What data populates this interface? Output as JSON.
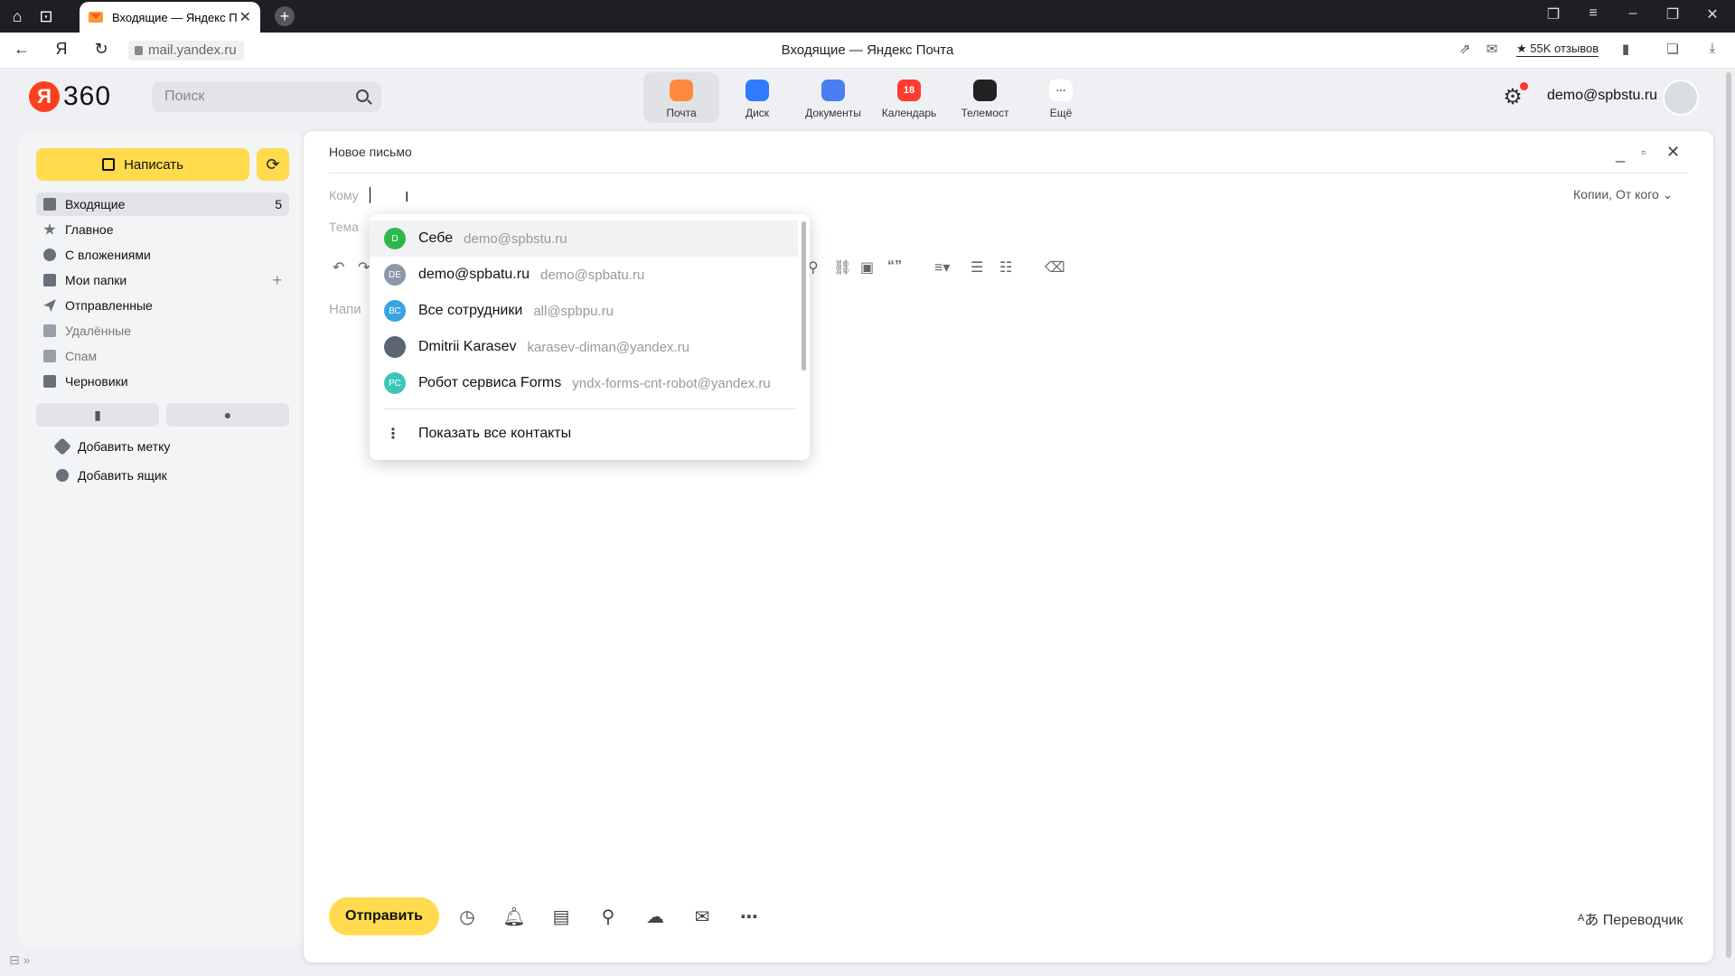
{
  "browser": {
    "tab_title": "Входящие — Яндекс П",
    "tab_close": "✕",
    "page_title": "Входящие — Яндекс Почта",
    "url": "mail.yandex.ru",
    "reviews": "★ 55K отзывов"
  },
  "header": {
    "logo_ya": "Я",
    "logo_360": "360",
    "search_placeholder": "Поиск",
    "services": [
      {
        "label": "Почта",
        "icon": "mail-icon",
        "color": "#ff8a3d"
      },
      {
        "label": "Диск",
        "icon": "disk-icon",
        "color": "#2f7bff"
      },
      {
        "label": "Документы",
        "icon": "documents-icon",
        "color": "#4a7ff0"
      },
      {
        "label": "Календарь",
        "icon": "calendar-icon",
        "color": "#ff3b30",
        "badge": "18"
      },
      {
        "label": "Телемост",
        "icon": "telemost-icon",
        "color": "#222222"
      },
      {
        "label": "Ещё",
        "icon": "more-icon",
        "color": "#ffffff",
        "glyph": "⋯"
      }
    ],
    "user_email": "demo@spbstu.ru"
  },
  "sidebar": {
    "compose_label": "Написать",
    "folders": [
      {
        "label": "Входящие",
        "count": "5"
      },
      {
        "label": "Главное"
      },
      {
        "label": "С вложениями"
      },
      {
        "label": "Мои папки",
        "add": "+"
      },
      {
        "label": "Отправленные"
      },
      {
        "label": "Удалённые"
      },
      {
        "label": "Спам"
      },
      {
        "label": "Черновики"
      }
    ],
    "add_label": "Добавить метку",
    "add_mailbox": "Добавить ящик"
  },
  "composer": {
    "title": "Новое письмо",
    "to_label": "Кому",
    "subject_label": "Тема",
    "copies_label": "Копии, От кого",
    "body_placeholder": "Напи",
    "send_label": "Отправить",
    "translator_label": "Переводчик"
  },
  "dropdown": {
    "contacts": [
      {
        "name": "Себе",
        "email": "demo@spbstu.ru",
        "initials": "D",
        "color": "#2db84d"
      },
      {
        "name": "demo@spbatu.ru",
        "email": "demo@spbatu.ru",
        "initials": "DE",
        "color": "#8d97a8"
      },
      {
        "name": "Все сотрудники",
        "email": "all@spbpu.ru",
        "initials": "ВС",
        "color": "#3aa3e3"
      },
      {
        "name": "Dmitrii Karasev",
        "email": "karasev-diman@yandex.ru",
        "initials": "",
        "color": "#5b6470"
      },
      {
        "name": "Робот сервиса Forms",
        "email": "yndx-forms-cnt-robot@yandex.ru",
        "initials": "РС",
        "color": "#3cc6b8"
      }
    ],
    "show_all": "Показать все контакты"
  }
}
